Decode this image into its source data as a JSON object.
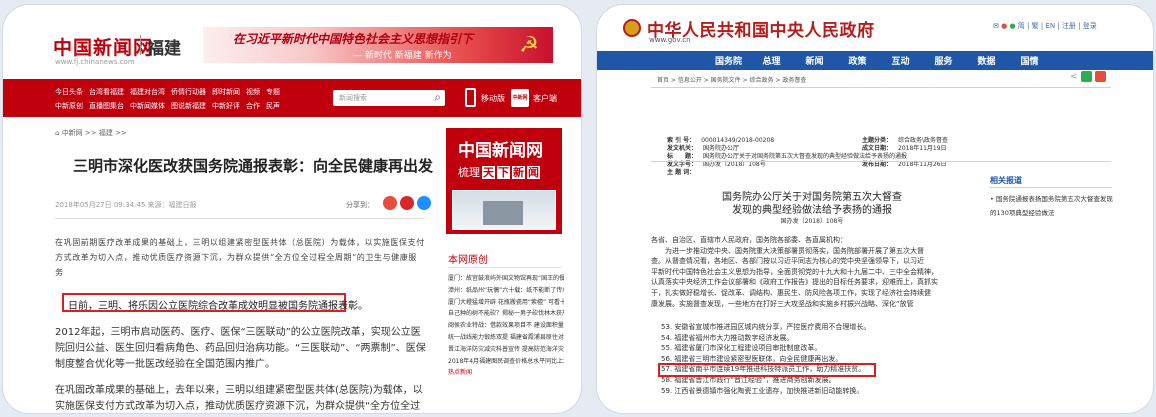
{
  "left": {
    "logo": "中国新闻网",
    "region": "福建",
    "url": "www.fj.chinanews.com",
    "banner": {
      "line1": "在习近平新时代中国特色社会主义思想指引下",
      "line2": "— 新时代 新福建 新作为"
    },
    "nav_row1": [
      "今日头条",
      "台湾看福建",
      "福建对台湾",
      "侨情行动器",
      "即时新闻",
      "视频",
      "专题"
    ],
    "nav_row2": [
      "中新原创",
      "直播图集台",
      "中新闻媒体",
      "图说新福建",
      "中新好评",
      "合作",
      "民声"
    ],
    "search_placeholder": "新闻搜索",
    "mobile_label": "移动版",
    "app_label": "客户端",
    "app_icon": "中新网",
    "breadcrumb": "中新网 >> 福建 >>",
    "article_title": "三明市深化医改获国务院通报表彰：向全民健康再出发",
    "meta": "2018年05月27日 09:34:45 来源：福建日报",
    "share_label": "分享到：",
    "para1": "在巩固前期医疗改革成果的基础上，三明以组建紧密型医共体（总医院）为载体，以实施医保支付方式改革为切入点，推动优质医疗资源下沉，为群众提供“全方位全过程全周期”的卫生与健康服务",
    "highlight": "日前，三明、将乐因公立医院综合改革成效明显被国务院通报表彰。",
    "para2": "2012年起，三明市启动医药、医疗、医保“三医联动”的公立医院改革，实现公立医院回归公益、医生回归看病角色、药品回归治病功能。“三医联动”、“两票制”、医保制度整合优化等一批医改经验在全国范围内推广。",
    "para3": "在巩固改革成果的基础上，去年以来，三明以组建紧密型医共体(总医院)为载体，以实施医保支付方式改革为切入点，推动优质医疗资源下沉，为群众提供“全方位全过程全周期”的卫生",
    "sidebar": {
      "logo": "中国新闻网",
      "slogan": "梳理",
      "slogan_tags": [
        "天",
        "下",
        "新",
        "闻"
      ]
    },
    "original_title": "本网原创",
    "news_list": [
      "厦门：故宫鼓浪屿外国文物馆再现“国王的餐桌”",
      "漳州：纸品州“玩偶”六十载：纸不能断了传承",
      "厦门大嶝猛增开辟 花瓶搬瓷用“紫檀” 可看十足",
      "自己种的树不能砍？揭秘一男子砍伐林木获刑一年",
      "闽侯农业特战：借款效果项目不 建设面积量和规划",
      "统一战线能力锻炼双提 福建省霞浦县原住对镇养殖",
      "晋江海洋防灾减灾科普宣传 提高防范海洋灾害意识",
      "2018年4月福建图民调查价格总水平同比上涨1.2%"
    ],
    "news_more": "热点新闻"
  },
  "right": {
    "title": "中华人民共和国中央人民政府",
    "url": "www.gov.cn",
    "top_links": "简 | 繁 | EN | 注册 | 登录",
    "nav": [
      "国务院",
      "总理",
      "新闻",
      "政策",
      "互动",
      "服务",
      "数据",
      "国情"
    ],
    "breadcrumb": "首页 > 信息公开 > 国务院文件 > 综合政务 > 政务督查",
    "info": {
      "r1": [
        [
          "索 引 号：",
          "000014349/2018-00208"
        ],
        [
          "主题分类：",
          "综合政务\\政务督查"
        ]
      ],
      "r2": [
        [
          "发文机关：",
          "国务院办公厅"
        ],
        [
          "成文日期：",
          "2018年11月19日"
        ]
      ],
      "r3": [
        [
          "标　　题：",
          "国务院办公厅关于对国务院第五次大督查发现的典型经验做法给予表扬的通报"
        ]
      ],
      "r4": [
        [
          "发文字号：",
          "国办发〔2018〕108号"
        ],
        [
          "发布日期：",
          "2018年11月26日"
        ]
      ],
      "r5": [
        [
          "主 题 词：",
          ""
        ]
      ]
    },
    "doc_title1": "国务院办公厅关于对国务院第五次大督查",
    "doc_title2": "发现的典型经验做法给予表扬的通报",
    "doc_no": "国办发〔2018〕108号",
    "body": [
      "各省、自治区、直辖市人民政府，国务院各部委、各直属机构：",
      "　　为进一步推动党中央、国务院重大决策部署贯彻落实，国务院部署开展了第五次大督",
      "查。从督查情况看，各地区、各部门按以习近平同志为核心的党中央坚强领导下，以习近",
      "平新时代中国特色社会主义思想为指导，全面贯彻党的十九大和十九届二中、三中全会精神，",
      "认真落实中央经济工作会议部署和《政府工作报告》提出的目标任务要求，迎难而上，真抓实",
      "干，扎实做好稳增长、促改革、调结构、惠民生、防风险各项工作，实现了经济社会持续健",
      "康发展。实施督查发现，一些地方在打好三大攻坚战和实施乡村振兴战略、深化“放管"
    ],
    "list": [
      "53. 安徽省宣城市推进园区城内统分享，严控医疗费用不合理增长。",
      "54. 福建省福州市大力推动数字经济发展。",
      "55. 福建省厦门市深化工程建设项目审批制度改革。",
      "56. 福建省三明市建设紧密型医联体，向全民健康再出发。",
      "57. 福建省南平市连续19年推进科技特派员工作，助力精准扶贫。",
      "58. 福建省晋江市践行“晋江经验”，推进商务创新发展。",
      "59. 江西省景德镇市强化陶瓷工业遗存，加快推进新旧动能转换。"
    ],
    "related_title": "相关报道",
    "related_item": "国务院通报表扬国务院第五次大督查发现的130项典型经验做法"
  },
  "colors": {
    "chinanews_red": "#c0000c",
    "gov_blue": "#1f56a5",
    "gov_red": "#b71c1c",
    "highlight_border": "#d91f1f"
  }
}
